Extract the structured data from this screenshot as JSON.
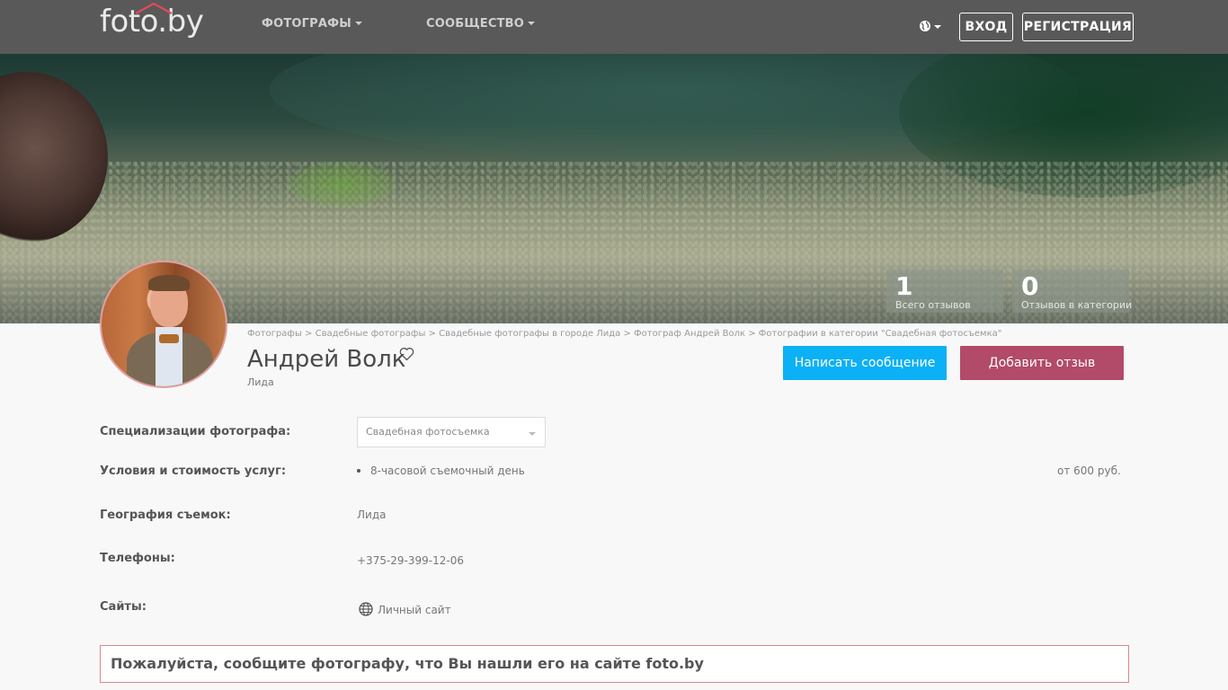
{
  "header": {
    "logo_text": "foto.by",
    "menu": [
      {
        "label": "ФОТОГРАФЫ"
      },
      {
        "label": "СООБЩЕСТВО"
      }
    ],
    "language_icon": "globe-icon",
    "login_label": "ВХОД",
    "register_label": "РЕГИСТРАЦИЯ"
  },
  "stats": [
    {
      "value": "1",
      "label": "Всего отзывов"
    },
    {
      "value": "0",
      "label": "Отзывов в категории"
    }
  ],
  "breadcrumbs": "Фотографы > Свадебные фотографы > Свадебные фотографы в городе Лида > Фотограф Андрей Волк > Фотографии в категории \"Свадебная фотосъемка\"",
  "profile": {
    "name": "Андрей Волк",
    "city": "Лида",
    "favorite_icon": "heart-icon"
  },
  "actions": {
    "message_label": "Написать сообщение",
    "review_label": "Добавить отзыв"
  },
  "details": {
    "specializations_label": "Специализации фотографа:",
    "specializations_value": "Свадебная фотосъемка",
    "services_label": "Условия и стоимость услуг:",
    "service_item": "8-часовой съемочный день",
    "service_price": "от 600 руб.",
    "geography_label": "География съемок:",
    "geography_value": "Лида",
    "phones_label": "Телефоны:",
    "phone_value": "+375-29-399-12-06",
    "sites_label": "Сайты:",
    "site_icon": "globe-icon",
    "site_value": "Личный сайт"
  },
  "notice": "Пожалуйста, сообщите фотографу, что Вы нашли его на сайте foto.by",
  "colors": {
    "topbar": "#595959",
    "message_button": "#0cb0f4",
    "review_button": "#b24a69",
    "notice_border": "#e3828c"
  }
}
